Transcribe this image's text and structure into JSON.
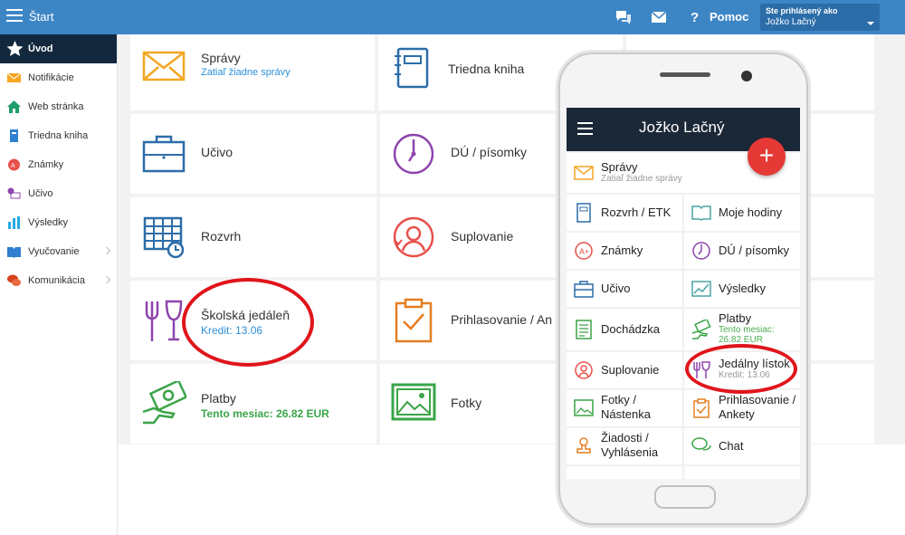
{
  "topbar": {
    "title": "Štart",
    "help_label": "Pomoc",
    "user_line1": "Ste prihlásený ako",
    "user_line2": "Jožko Lačný"
  },
  "sidebar": {
    "items": [
      {
        "label": "Úvod",
        "icon": "star-icon"
      },
      {
        "label": "Notifikácie",
        "icon": "envelope-icon"
      },
      {
        "label": "Web stránka",
        "icon": "home-icon"
      },
      {
        "label": "Triedna kniha",
        "icon": "book-icon"
      },
      {
        "label": "Známky",
        "icon": "grade-icon"
      },
      {
        "label": "Učivo",
        "icon": "easel-icon"
      },
      {
        "label": "Výsledky",
        "icon": "bar-chart-icon"
      },
      {
        "label": "Vyučovanie",
        "icon": "book-open-icon"
      },
      {
        "label": "Komunikácia",
        "icon": "chat-icon"
      }
    ]
  },
  "tiles": {
    "spravy": {
      "title": "Správy",
      "subtitle": "Zatiaľ žiadne správy"
    },
    "triedna": {
      "title": "Triedna kniha"
    },
    "ucivo": {
      "title": "Učivo"
    },
    "du": {
      "title": "DÚ / písomky"
    },
    "rozvrh": {
      "title": "Rozvrh"
    },
    "suplovanie": {
      "title": "Suplovanie"
    },
    "jedalen": {
      "title": "Školská jedáleň",
      "subtitle": "Kredit: 13.06"
    },
    "prihlasovanie": {
      "title": "Prihlasovanie / An"
    },
    "platby": {
      "title": "Platby",
      "subtitle": "Tento mesiac: 26.82 EUR"
    },
    "fotky": {
      "title": "Fotky"
    }
  },
  "phone": {
    "app_title": "Jožko Lačný",
    "fab": "+",
    "spravy": {
      "title": "Správy",
      "subtitle": "Zatiaľ žiadne správy"
    },
    "tiles": [
      {
        "title": "Rozvrh / ETK"
      },
      {
        "title": "Moje hodiny"
      },
      {
        "title": "Známky"
      },
      {
        "title": "DÚ / písomky"
      },
      {
        "title": "Učivo"
      },
      {
        "title": "Výsledky"
      },
      {
        "title": "Dochádzka"
      },
      {
        "title": "Platby",
        "subtitle": "Tento mesiac: 26.82 EUR"
      },
      {
        "title": "Suplovanie"
      },
      {
        "title": "Jedálny lístok",
        "subtitle": "Kredit: 13.06"
      },
      {
        "title": "Fotky / Nástenka"
      },
      {
        "title": "Prihlasovanie / Ankety"
      },
      {
        "title": "Žiadosti / Vyhlásenia"
      },
      {
        "title": "Chat"
      }
    ]
  },
  "colors": {
    "topbar": "#3d86c6",
    "active_sidebar": "#13283d",
    "accent_red": "#e0151b",
    "link_blue": "#2b8fd6",
    "green": "#3aa447"
  }
}
